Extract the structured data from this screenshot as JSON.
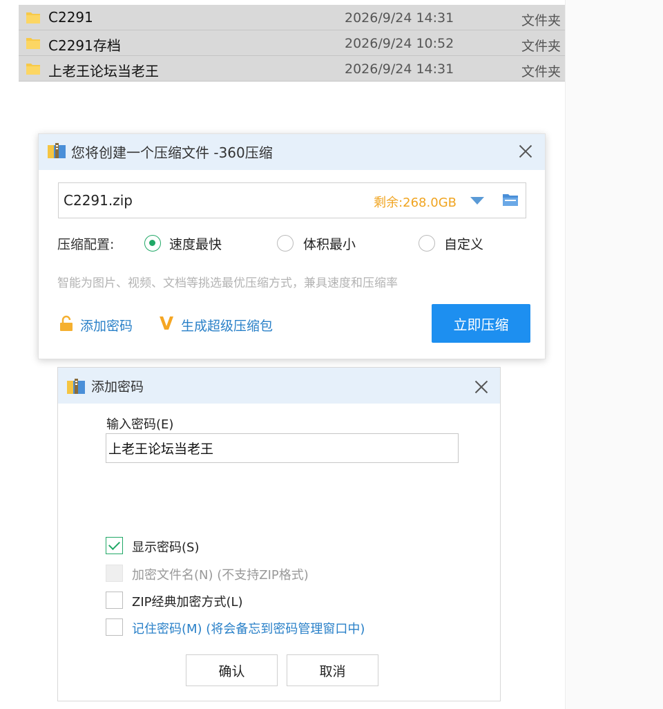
{
  "file_list": [
    {
      "name": "C2291",
      "date": "2026/9/24 14:31",
      "type": "文件夹"
    },
    {
      "name": "C2291存档",
      "date": "2026/9/24 10:52",
      "type": "文件夹"
    },
    {
      "name": "上老王论坛当老王",
      "date": "2026/9/24 14:31",
      "type": "文件夹"
    }
  ],
  "compress_dialog": {
    "title": "您将创建一个压缩文件 -360压缩",
    "filename": "C2291.zip",
    "remaining": "剩余:268.0GB",
    "config_label": "压缩配置:",
    "options": [
      {
        "label": "速度最快",
        "selected": true
      },
      {
        "label": "体积最小",
        "selected": false
      },
      {
        "label": "自定义",
        "selected": false
      }
    ],
    "hint": "智能为图片、视频、文档等挑选最优压缩方式，兼具速度和压缩率",
    "add_password": "添加密码",
    "super_package": "生成超级压缩包",
    "compress_now": "立即压缩",
    "colors": {
      "accent": "#1d8ff0",
      "remain": "#f0a420",
      "link": "#2980c8",
      "check": "#20a866"
    }
  },
  "password_dialog": {
    "title": "添加密码",
    "input_label": "输入密码(E)",
    "password_value": "上老王论坛当老王",
    "checkboxes": [
      {
        "label": "显示密码(S)",
        "checked": true,
        "disabled": false
      },
      {
        "label": "加密文件名(N) (不支持ZIP格式)",
        "checked": false,
        "disabled": true
      },
      {
        "label": "ZIP经典加密方式(L)",
        "checked": false,
        "disabled": false
      },
      {
        "label": "记住密码(M) (将会备忘到密码管理窗口中)",
        "checked": false,
        "disabled": false
      }
    ],
    "ok": "确认",
    "cancel": "取消"
  }
}
